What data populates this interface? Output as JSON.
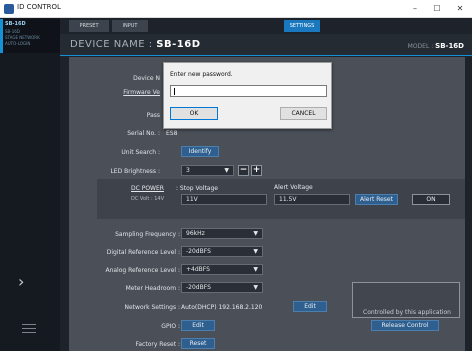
{
  "window": {
    "title": "ID CONTROL",
    "min": "–",
    "max": "☐",
    "close": "✕"
  },
  "leftnav": {
    "device_label": "SB-16D",
    "device_line1": "SB-16D",
    "device_line2": "STAGE NETWORK",
    "device_line3": "AUTO-LOGIN",
    "expand_glyph": "›"
  },
  "tabs": {
    "preset": "PRESET",
    "input": "INPUT",
    "settings": "SETTINGS"
  },
  "header": {
    "device_name_prefix": "DEVICE NAME : ",
    "device_name": "SB-16D",
    "model_prefix": "MODEL : ",
    "model": "SB-16D"
  },
  "settings": {
    "device_name_label": "Device N",
    "firmware_label": "Firmware Ve",
    "password_label": "Pass",
    "serial_label": "Serial No. :",
    "serial_value": "ES8",
    "unit_search_label": "Unit Search :",
    "identify_button": "Identify",
    "led_label": "LED Brightness :",
    "led_value": "3",
    "minus": "−",
    "plus": "+",
    "dc_power_label": "DC POWER",
    "dc_volt_label": "DC Volt : 14V",
    "stop_voltage_label": ": Stop Voltage",
    "stop_voltage_value": "11V",
    "alert_voltage_label": "Alert Voltage",
    "alert_voltage_value": "11.5V",
    "alert_reset_button": "Alert Reset",
    "on_button": "ON",
    "sampling_label": "Sampling Frequency :",
    "sampling_value": "96kHz",
    "digital_ref_label": "Digital Reference Level :",
    "digital_ref_value": "-20dBFS",
    "analog_ref_label": "Analog Reference Level :",
    "analog_ref_value": "+4dBFS",
    "meter_label": "Meter Headroom :",
    "meter_value": "-20dBFS",
    "network_label": "Network Settings :",
    "network_value": "Auto(DHCP) 192.168.2.120",
    "network_edit": "Edit",
    "gpio_label": "GPIO :",
    "gpio_edit": "Edit",
    "factory_label": "Factory Reset :",
    "reset_button": "Reset",
    "controlled_text": "Controlled by this application",
    "release_button": "Release Control"
  },
  "dialog": {
    "message": "Enter new password.",
    "password_value": "",
    "ok": "OK",
    "cancel": "CANCEL"
  },
  "colors": {
    "accent": "#1591d6",
    "settings_tab": "#1a78be"
  }
}
